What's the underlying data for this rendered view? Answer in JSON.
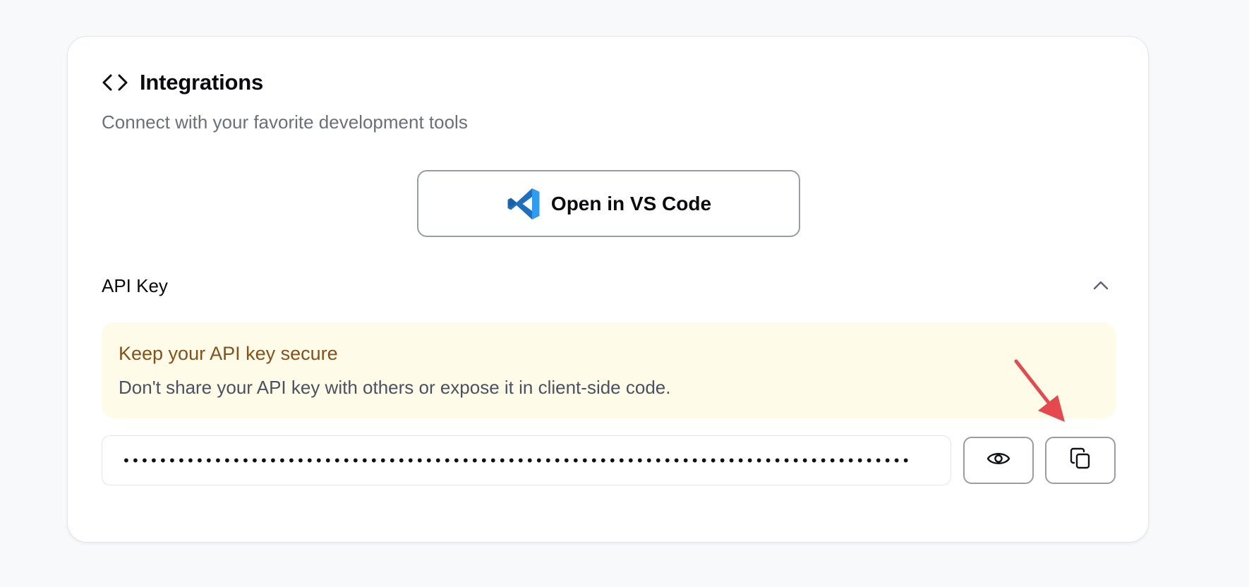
{
  "integrations": {
    "title": "Integrations",
    "subtitle": "Connect with your favorite development tools",
    "title_icon": "code-brackets-icon"
  },
  "vscode_button": {
    "label": "Open in VS Code",
    "icon": "vscode-logo-icon"
  },
  "api_key": {
    "section_label": "API Key",
    "toggle_icon": "chevron-up-icon",
    "warning": {
      "title": "Keep your API key secure",
      "text": "Don't share your API key with others or expose it in client-side code."
    },
    "masked_value": "••••••••••••••••••••••••••••••••••••••••••••••••••••••••••••••••••••••••••••••••••••••",
    "show_icon": "eye-icon",
    "copy_icon": "copy-icon"
  },
  "annotation": {
    "arrow_color": "#e5484d",
    "arrow_icon": "red-arrow-annotation-icon"
  },
  "colors": {
    "warning_bg": "#fefce8",
    "warning_title": "#85501a",
    "vscode_blue": "#2b8fe0"
  }
}
